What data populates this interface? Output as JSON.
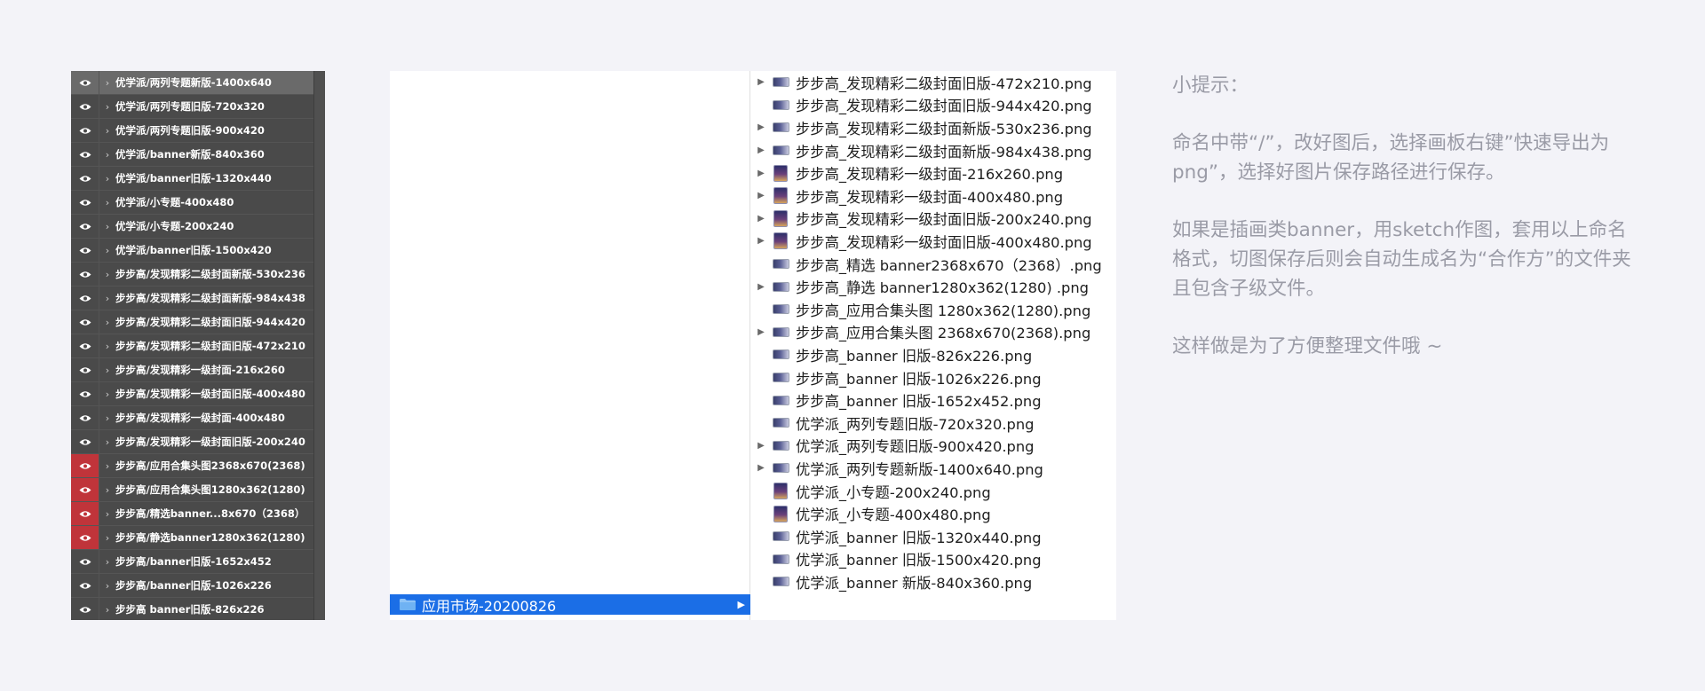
{
  "layers": {
    "items": [
      {
        "name": "优学派/两列专题新版-1400x640",
        "eye": "normal",
        "selected": true
      },
      {
        "name": "优学派/两列专题旧版-720x320",
        "eye": "normal"
      },
      {
        "name": "优学派/两列专题旧版-900x420",
        "eye": "normal"
      },
      {
        "name": "优学派/banner新版-840x360",
        "eye": "normal"
      },
      {
        "name": "优学派/banner旧版-1320x440",
        "eye": "normal"
      },
      {
        "name": "优学派/小专题-400x480",
        "eye": "normal"
      },
      {
        "name": "优学派/小专题-200x240",
        "eye": "normal"
      },
      {
        "name": "优学派/banner旧版-1500x420",
        "eye": "normal"
      },
      {
        "name": "步步高/发现精彩二级封面新版-530x236",
        "eye": "normal"
      },
      {
        "name": "步步高/发现精彩二级封面新版-984x438",
        "eye": "normal"
      },
      {
        "name": "步步高/发现精彩二级封面旧版-944x420",
        "eye": "normal"
      },
      {
        "name": "步步高/发现精彩二级封面旧版-472x210",
        "eye": "normal"
      },
      {
        "name": "步步高/发现精彩一级封面-216x260",
        "eye": "normal"
      },
      {
        "name": "步步高/发现精彩一级封面旧版-400x480",
        "eye": "normal"
      },
      {
        "name": "步步高/发现精彩一级封面-400x480",
        "eye": "normal"
      },
      {
        "name": "步步高/发现精彩一级封面旧版-200x240",
        "eye": "normal"
      },
      {
        "name": "步步高/应用合集头图2368x670(2368)",
        "eye": "red"
      },
      {
        "name": "步步高/应用合集头图1280x362(1280)",
        "eye": "red"
      },
      {
        "name": "步步高/精选banner...8x670（2368）",
        "eye": "red"
      },
      {
        "name": "步步高/静选banner1280x362(1280)",
        "eye": "red"
      },
      {
        "name": "步步高/banner旧版-1652x452",
        "eye": "normal"
      },
      {
        "name": "步步高/banner旧版-1026x226",
        "eye": "normal"
      },
      {
        "name": "步步高 banner旧版-826x226",
        "eye": "normal"
      }
    ]
  },
  "finder": {
    "folder": {
      "name": "应用市场-20200826"
    },
    "files": [
      {
        "name": "步步高_发现精彩二级封面旧版-472x210.png",
        "thumb": "wide",
        "arrow": true
      },
      {
        "name": "步步高_发现精彩二级封面旧版-944x420.png",
        "thumb": "wide",
        "arrow": false
      },
      {
        "name": "步步高_发现精彩二级封面新版-530x236.png",
        "thumb": "wide",
        "arrow": true
      },
      {
        "name": "步步高_发现精彩二级封面新版-984x438.png",
        "thumb": "wide",
        "arrow": true
      },
      {
        "name": "步步高_发现精彩一级封面-216x260.png",
        "thumb": "tall",
        "arrow": true
      },
      {
        "name": "步步高_发现精彩一级封面-400x480.png",
        "thumb": "tall",
        "arrow": true
      },
      {
        "name": "步步高_发现精彩一级封面旧版-200x240.png",
        "thumb": "tall",
        "arrow": true
      },
      {
        "name": "步步高_发现精彩一级封面旧版-400x480.png",
        "thumb": "tall",
        "arrow": true
      },
      {
        "name": "步步高_精选 banner2368x670（2368）.png",
        "thumb": "wide",
        "arrow": false
      },
      {
        "name": "步步高_静选 banner1280x362(1280) .png",
        "thumb": "wide",
        "arrow": true
      },
      {
        "name": "步步高_应用合集头图 1280x362(1280).png",
        "thumb": "wide",
        "arrow": false
      },
      {
        "name": "步步高_应用合集头图 2368x670(2368).png",
        "thumb": "wide",
        "arrow": true
      },
      {
        "name": "步步高_banner 旧版-826x226.png",
        "thumb": "wide",
        "arrow": false
      },
      {
        "name": "步步高_banner 旧版-1026x226.png",
        "thumb": "wide",
        "arrow": false
      },
      {
        "name": "步步高_banner 旧版-1652x452.png",
        "thumb": "wide",
        "arrow": false
      },
      {
        "name": "优学派_两列专题旧版-720x320.png",
        "thumb": "wide",
        "arrow": false
      },
      {
        "name": "优学派_两列专题旧版-900x420.png",
        "thumb": "wide",
        "arrow": true
      },
      {
        "name": "优学派_两列专题新版-1400x640.png",
        "thumb": "wide",
        "arrow": true
      },
      {
        "name": "优学派_小专题-200x240.png",
        "thumb": "tall",
        "arrow": false
      },
      {
        "name": "优学派_小专题-400x480.png",
        "thumb": "tall",
        "arrow": false
      },
      {
        "name": "优学派_banner 旧版-1320x440.png",
        "thumb": "wide",
        "arrow": false
      },
      {
        "name": "优学派_banner 旧版-1500x420.png",
        "thumb": "wide",
        "arrow": false
      },
      {
        "name": "优学派_banner 新版-840x360.png",
        "thumb": "wide",
        "arrow": false
      }
    ]
  },
  "tips": {
    "title": "小提示：",
    "para1": "命名中带“/”，改好图后，选择画板右键”快速导出为png”，选择好图片保存路径进行保存。",
    "para2": "如果是插画类banner，用sketch作图，套用以上命名格式，切图保存后则会自动生成名为“合作方”的文件夹且包含子级文件。",
    "para3": "这样做是为了方便整理文件哦 ~"
  },
  "colors": {
    "selection": "#1b6ee6",
    "eye_red": "#c0343a",
    "panel": "#4a4a4a"
  },
  "icons": {
    "eye": "eye-icon",
    "chevron": "chevron-right-icon",
    "folder": "folder-icon",
    "disclosure": "disclosure-triangle-icon"
  }
}
